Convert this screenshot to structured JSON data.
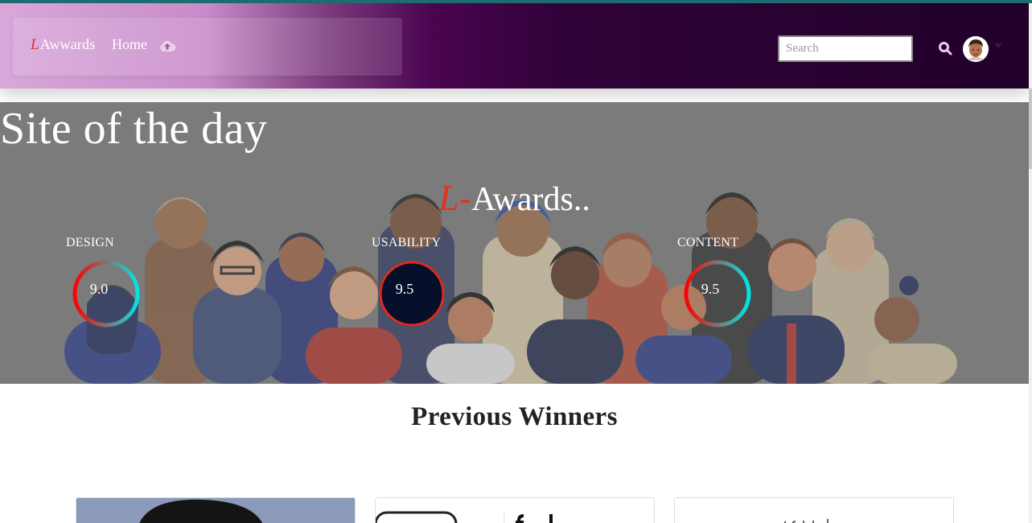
{
  "nav": {
    "brand_glyph": "L",
    "brand_text": "Awwards",
    "home_label": "Home",
    "upload_icon": "cloud-upload-icon",
    "search_placeholder": "Search",
    "search_icon": "search-icon",
    "avatar_icon": "user-avatar",
    "colors": {
      "gradient_start": "#d9a7da",
      "gradient_mid": "#4b0450",
      "gradient_end": "#21012a"
    }
  },
  "hero": {
    "title": "Site of the day",
    "brand_glyph": "L-",
    "brand_text": "Awards..",
    "scores": [
      {
        "label": "DESIGN",
        "value": "9.0"
      },
      {
        "label": "USABILITY",
        "value": "9.5"
      },
      {
        "label": "CONTENT",
        "value": "9.5"
      }
    ]
  },
  "winners": {
    "title": "Previous Winners"
  }
}
